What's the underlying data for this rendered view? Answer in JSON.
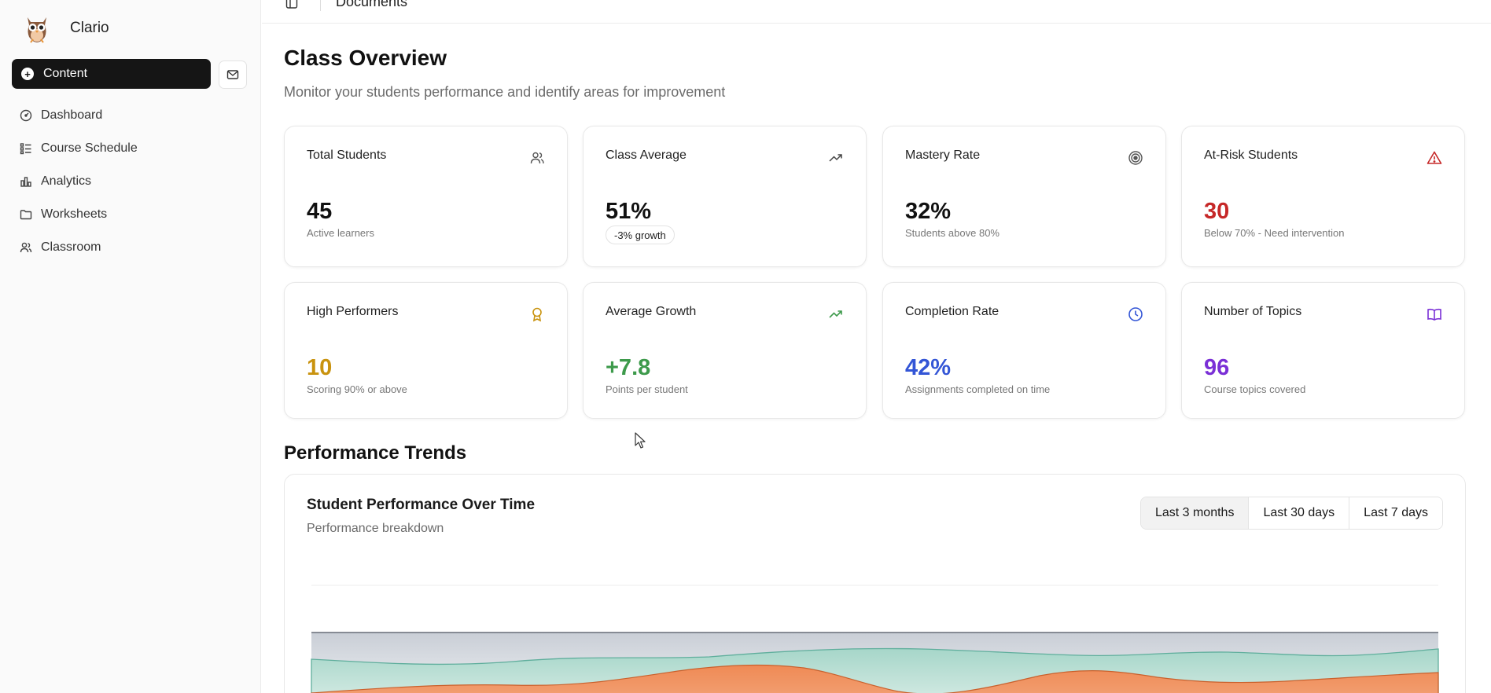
{
  "app": {
    "name": "Clario"
  },
  "sidebar": {
    "primary_label": "Content",
    "items": [
      {
        "label": "Dashboard",
        "icon": "gauge-icon"
      },
      {
        "label": "Course Schedule",
        "icon": "list-icon"
      },
      {
        "label": "Analytics",
        "icon": "bar-chart-icon"
      },
      {
        "label": "Worksheets",
        "icon": "folder-icon"
      },
      {
        "label": "Classroom",
        "icon": "users-icon"
      }
    ]
  },
  "topbar": {
    "breadcrumb": "Documents"
  },
  "page": {
    "title": "Class Overview",
    "subtitle": "Monitor your students performance and identify areas for improvement"
  },
  "stats": [
    {
      "title": "Total Students",
      "value": "45",
      "sub": "Active learners",
      "icon": "users-icon",
      "color": "#111111"
    },
    {
      "title": "Class Average",
      "value": "51%",
      "badge": "-3% growth",
      "icon": "trend-up-icon",
      "color": "#111111"
    },
    {
      "title": "Mastery Rate",
      "value": "32%",
      "sub": "Students above 80%",
      "icon": "target-icon",
      "color": "#111111"
    },
    {
      "title": "At-Risk Students",
      "value": "30",
      "sub": "Below 70% - Need intervention",
      "icon": "alert-triangle-icon",
      "color": "#c62828"
    },
    {
      "title": "High Performers",
      "value": "10",
      "sub": "Scoring 90% or above",
      "icon": "award-icon",
      "color": "#c9930f"
    },
    {
      "title": "Average Growth",
      "value": "+7.8",
      "sub": "Points per student",
      "icon": "trend-up-icon",
      "color": "#3d9a4b"
    },
    {
      "title": "Completion Rate",
      "value": "42%",
      "sub": "Assignments completed on time",
      "icon": "clock-icon",
      "color": "#3355d6"
    },
    {
      "title": "Number of Topics",
      "value": "96",
      "sub": "Course topics covered",
      "icon": "book-icon",
      "color": "#7a2fd6"
    }
  ],
  "trends": {
    "section_title": "Performance Trends",
    "card_title": "Student Performance Over Time",
    "card_subtitle": "Performance breakdown",
    "ranges": [
      "Last 3 months",
      "Last 30 days",
      "Last 7 days"
    ],
    "active_range": 0
  },
  "colors": {
    "accent_dark": "#151515",
    "series_teal": "#7cc3b2",
    "series_orange": "#ef8a55"
  }
}
